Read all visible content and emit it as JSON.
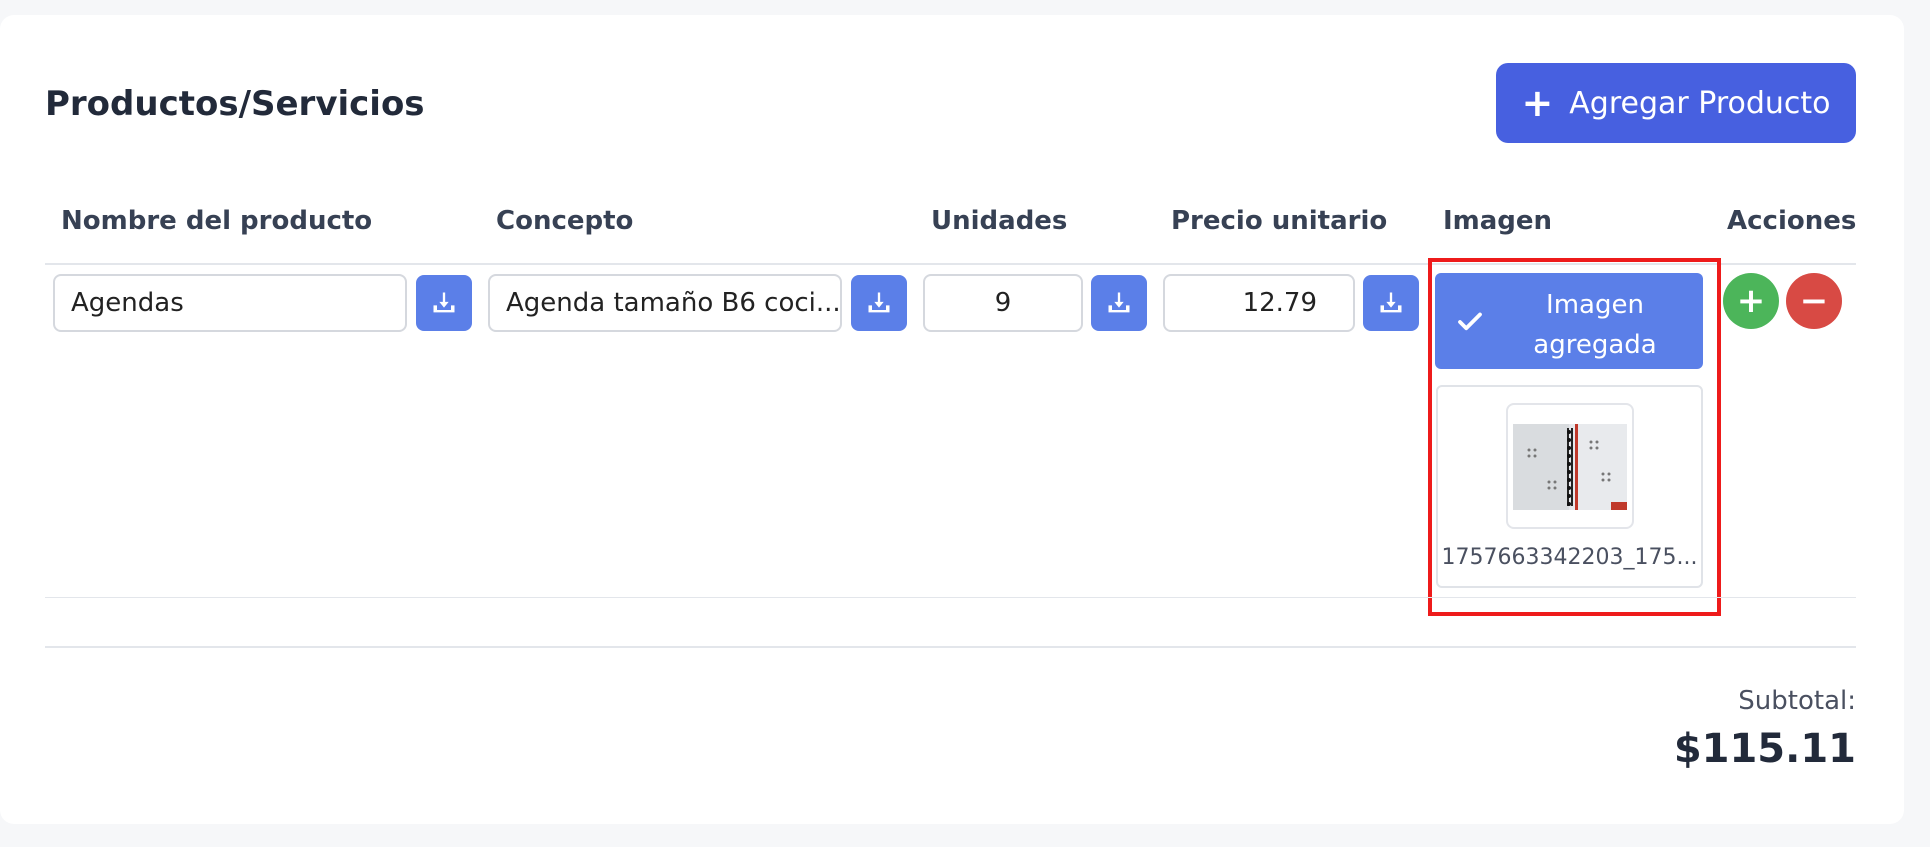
{
  "section": {
    "title": "Productos/Servicios",
    "add_button_label": "Agregar Producto"
  },
  "table": {
    "headers": [
      "Nombre del producto",
      "Concepto",
      "Unidades",
      "Precio unitario",
      "Imagen",
      "Acciones"
    ],
    "row": {
      "nombre": "Agendas",
      "concepto": "Agenda tamaño B6 coci...",
      "unidades": "9",
      "precio_unitario": "12.79",
      "imagen_button_label": "Imagen agregada",
      "imagen_filename": "1757663342203_175..."
    }
  },
  "summary": {
    "subtotal_label": "Subtotal:",
    "subtotal_value": "$115.11"
  },
  "colors": {
    "primary": "#4760e0",
    "download_button": "#5b7fe8",
    "add_row": "#4cb55a",
    "remove_row": "#d84a44",
    "highlight": "#ee1b1b"
  },
  "icons": [
    "plus-icon",
    "download-icon",
    "check-icon",
    "add-row-icon",
    "remove-row-icon"
  ]
}
